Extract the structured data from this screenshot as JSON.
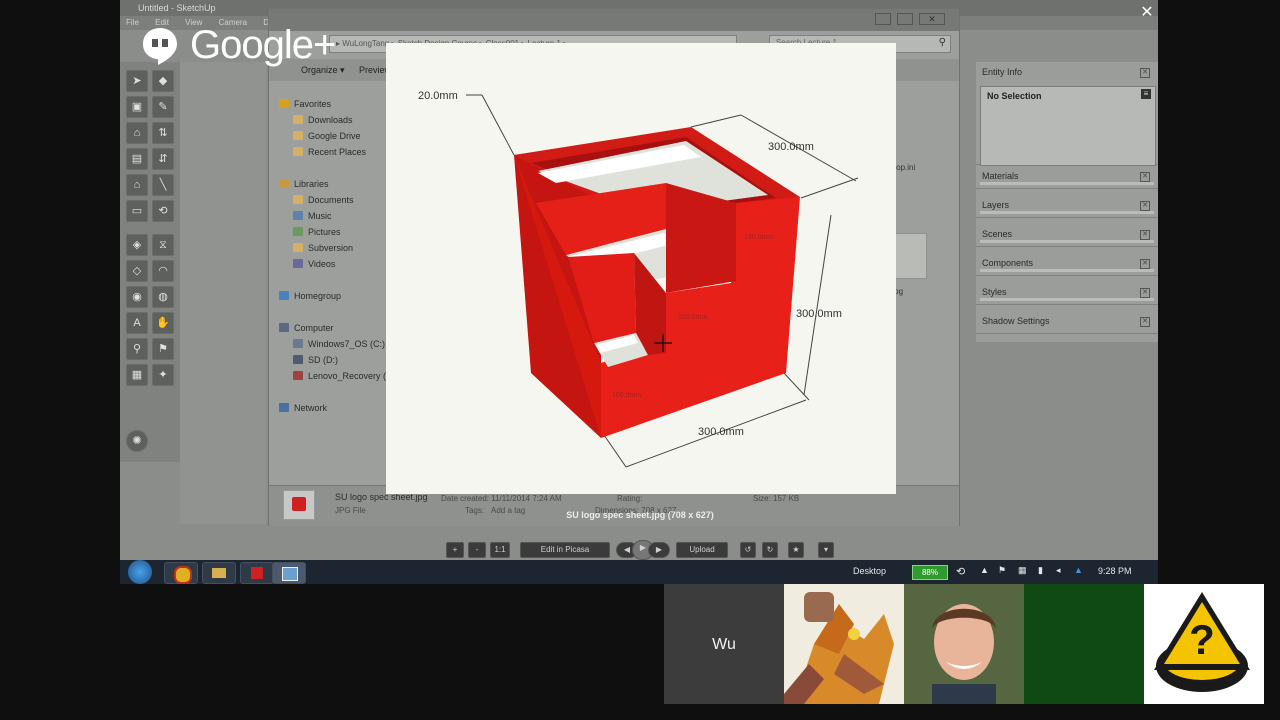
{
  "sketchup": {
    "window_title": "Untitled - SketchUp",
    "menu": [
      "File",
      "Edit",
      "View",
      "Camera",
      "Draw"
    ]
  },
  "explorer": {
    "breadcrumb": "▸ WuLongTang ▸ Sketch Design Course ▸ Class001 ▸ Lecture 1 ▸",
    "search_placeholder": "Search Lecture 1",
    "organize_label": "Organize ▾",
    "preview_label": "Preview",
    "nav_items": [
      {
        "label": "Favorites",
        "icon": "star-icon",
        "color": "#d9a020"
      },
      {
        "label": "Downloads",
        "icon": "folder-icon",
        "color": "#d4b060"
      },
      {
        "label": "Google Drive",
        "icon": "folder-icon",
        "color": "#d4b060"
      },
      {
        "label": "Recent Places",
        "icon": "folder-icon",
        "color": "#d4b060"
      },
      {
        "label": "Libraries",
        "icon": "library-icon",
        "color": "#c89a40"
      },
      {
        "label": "Documents",
        "icon": "document-icon",
        "color": "#d4b060"
      },
      {
        "label": "Music",
        "icon": "music-icon",
        "color": "#6080b0"
      },
      {
        "label": "Pictures",
        "icon": "picture-icon",
        "color": "#6a9a60"
      },
      {
        "label": "Subversion",
        "icon": "folder-icon",
        "color": "#d4b060"
      },
      {
        "label": "Videos",
        "icon": "video-icon",
        "color": "#6a6a9a"
      },
      {
        "label": "Homegroup",
        "icon": "homegroup-icon",
        "color": "#4a80c0"
      },
      {
        "label": "Computer",
        "icon": "computer-icon",
        "color": "#5a6a80"
      },
      {
        "label": "Windows7_OS (C:)",
        "icon": "drive-icon",
        "color": "#6a7a90"
      },
      {
        "label": "SD (D:)",
        "icon": "drive-icon",
        "color": "#505a70"
      },
      {
        "label": "Lenovo_Recovery (Q:)",
        "icon": "drive-icon",
        "color": "#a04040"
      },
      {
        "label": "Network",
        "icon": "network-icon",
        "color": "#4a70a0"
      }
    ],
    "file_items": [
      "desktop.ini",
      "x-ray.jpg"
    ],
    "status": {
      "filename": "SU logo spec sheet.jpg",
      "filetype": "JPG File",
      "date_label": "Date created: 11/11/2014 7:24 AM",
      "tags_label": "Tags:",
      "tags_value": "Add a tag",
      "rating_label": "Rating:",
      "dimensions_label": "Dimensions: 708 x 627",
      "size_label": "Size: 157 KB"
    }
  },
  "side_panel": {
    "entity_info": "Entity Info",
    "no_selection": "No Selection",
    "trays": [
      "Materials",
      "Layers",
      "Scenes",
      "Components",
      "Styles",
      "Shadow Settings"
    ]
  },
  "viewer": {
    "caption": "SU logo spec sheet.jpg (708 x 627)",
    "dim_top": "20.0mm",
    "dim_width_top": "300.0mm",
    "dim_height": "300.0mm",
    "dim_width_bottom": "300.0mm",
    "dim_inner_1": "100.0mm",
    "dim_inner_2": "100.0mm",
    "dim_inner_3": "100.0mm",
    "controls": {
      "plus": "+",
      "minus": "-",
      "one_to_one": "1:1",
      "edit": "Edit in Picasa",
      "upload": "Upload"
    },
    "colors": {
      "cube_front": "#e8201a",
      "cube_side": "#c41510",
      "cube_top": "#d11b15",
      "paper": "#f4f6ef"
    }
  },
  "google_plus": {
    "logo_text": "Google+"
  },
  "taskbar": {
    "desktop_label": "Desktop",
    "battery": "88%",
    "clock": "9:28 PM"
  },
  "participants": {
    "wu_label": "Wu"
  }
}
